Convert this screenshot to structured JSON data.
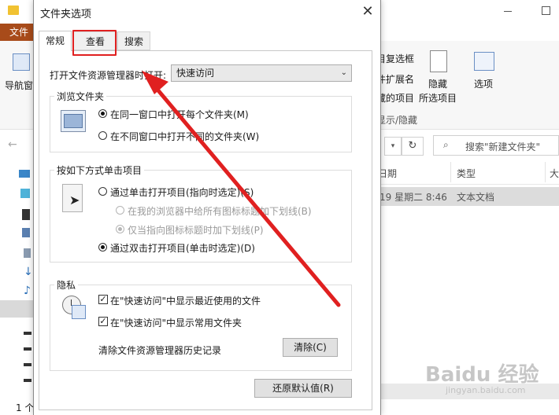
{
  "explorer": {
    "ribbon_tab_label": "文件",
    "nav_pane_label": "导航窗",
    "ribbon": {
      "item_checkbox_label": "项目复选框",
      "file_ext_label": "文件扩展名",
      "hidden_items_label": "隐藏的项目",
      "hide_label": "隐藏",
      "hide_selected_label": "所选项目",
      "options_label": "选项",
      "group_label": "显示/隐藏"
    },
    "search_placeholder": "搜索\"新建文件夹\"",
    "columns": {
      "date_fragment": "日期",
      "type": "类型",
      "size_fragment": "大"
    },
    "row": {
      "date": "19 星期二 8:46",
      "type": "文本文档"
    },
    "status_count": "1 个"
  },
  "dialog": {
    "title": "文件夹选项",
    "close_label": "✕",
    "tabs": [
      {
        "label": "常规"
      },
      {
        "label": "查看"
      },
      {
        "label": "搜索"
      }
    ],
    "open_label": "打开文件资源管理器时打开:",
    "open_value": "快速访问",
    "browse_group": {
      "title": "浏览文件夹",
      "option1": "在同一窗口中打开每个文件夹(M)",
      "option2": "在不同窗口中打开不同的文件夹(W)"
    },
    "click_group": {
      "title": "按如下方式单击项目",
      "option1": "通过单击打开项目(指向时选定)(S)",
      "sub1": "在我的浏览器中给所有图标标题加下划线(B)",
      "sub2": "仅当指向图标标题时加下划线(P)",
      "option2": "通过双击打开项目(单击时选定)(D)"
    },
    "privacy_group": {
      "title": "隐私",
      "check1": "在\"快速访问\"中显示最近使用的文件",
      "check2": "在\"快速访问\"中显示常用文件夹",
      "clear_label": "清除文件资源管理器历史记录",
      "clear_button": "清除(C)"
    },
    "restore_button": "还原默认值(R)"
  },
  "watermark": {
    "logo": "Baidu 经验",
    "url": "jingyan.baidu.com"
  },
  "colors": {
    "accent_red": "#e02020",
    "ribbon_tab": "#a84b1a"
  }
}
